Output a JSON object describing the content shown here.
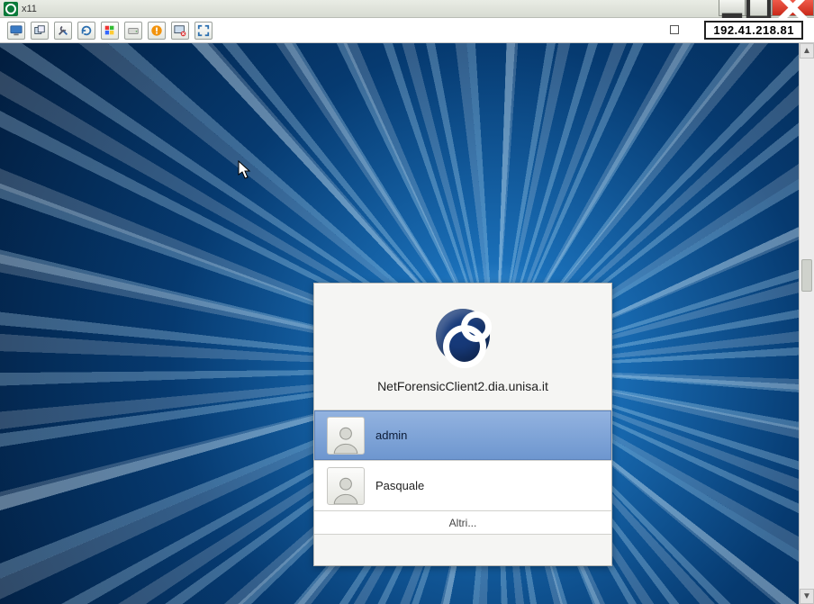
{
  "window": {
    "title": "x11"
  },
  "toolbar": {
    "icons": [
      "monitor-icon",
      "windows-overlap-icon",
      "tools-icon",
      "refresh-icon",
      "windows-flag-icon",
      "drive-icon",
      "alert-icon",
      "screen-x-icon",
      "fullscreen-icon"
    ],
    "ip": "192.41.218.81"
  },
  "login": {
    "hostname": "NetForensicClient2.dia.unisa.it",
    "users": [
      {
        "name": "admin",
        "selected": true
      },
      {
        "name": "Pasquale",
        "selected": false
      }
    ],
    "other_label": "Altri..."
  }
}
